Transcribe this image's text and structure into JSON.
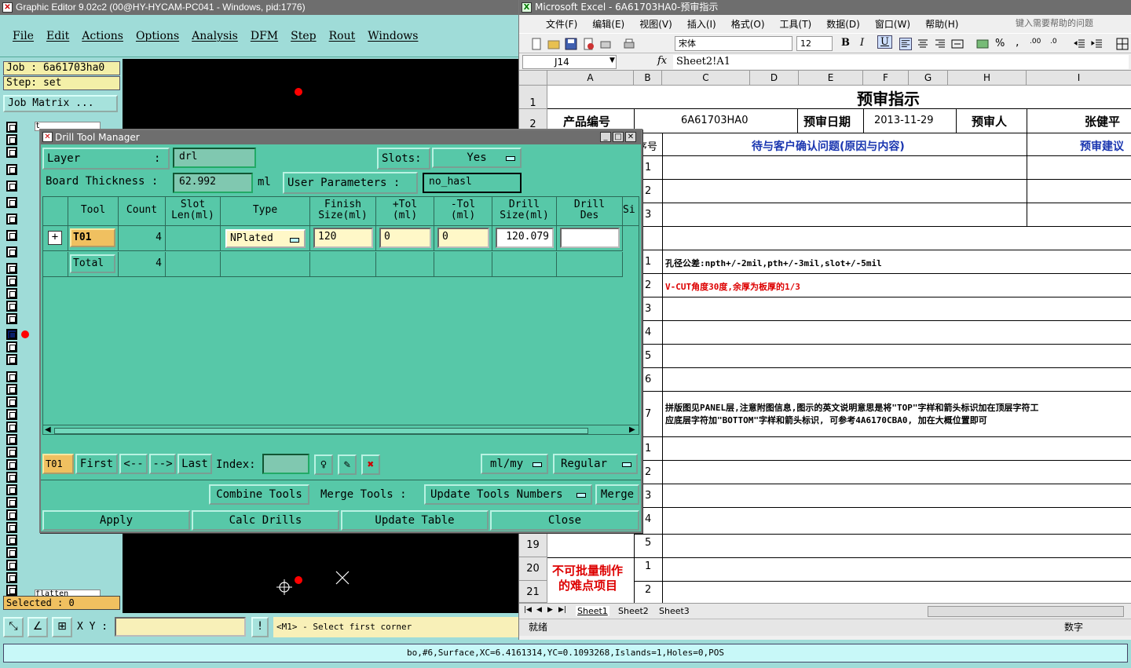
{
  "graphic_editor": {
    "title": "Graphic Editor 9.02c2 (00@HY-HYCAM-PC041 - Windows, pid:1776)",
    "menu": [
      "File",
      "Edit",
      "Actions",
      "Options",
      "Analysis",
      "DFM",
      "Step",
      "Rout",
      "Windows"
    ],
    "job_label": "Job : 6a61703ha0",
    "step_label": "Step: set",
    "job_matrix_button": "Job Matrix ...",
    "layer_last_name": "flatten",
    "layer_first_name": "t",
    "selected_label": "Selected : 0",
    "xy_label": "X Y :",
    "xy_value": "",
    "status_message": "<M1> - Select first corner",
    "bottom_info": "bo,#6,Surface,XC=6.4161314,YC=0.1093268,Islands=1,Holes=0,POS"
  },
  "drill_tool_manager": {
    "title": "Drill Tool Manager",
    "layer_label": "Layer",
    "layer_colon": ":",
    "layer_value": "drl",
    "slots_label": "Slots:",
    "slots_value": "Yes",
    "board_thickness_label": "Board Thickness :",
    "board_thickness_value": "62.992",
    "board_thickness_unit": "ml",
    "user_parameters_label": "User Parameters :",
    "user_parameters_value": "no_hasl",
    "columns": [
      "Tool",
      "Count",
      "Slot Len(ml)",
      "Type",
      "Finish Size(ml)",
      "+Tol (ml)",
      "-Tol (ml)",
      "Drill Size(ml)",
      "Drill Des",
      "Si"
    ],
    "row_tool": "T01",
    "row_count": "4",
    "row_type": "NPlated",
    "row_finish": "120",
    "row_ptol": "0",
    "row_ntol": "0",
    "row_drill_size": "120.079",
    "row_drill_des": "",
    "total_label": "Total",
    "total_count": "4",
    "nav_tool": "T01",
    "nav_first": "First",
    "nav_prev": "<--",
    "nav_next": "-->",
    "nav_last": "Last",
    "index_label": "Index:",
    "index_value": "",
    "units_value": "ml/my",
    "mode_value": "Regular",
    "combine_tools": "Combine Tools",
    "merge_tools_label": "Merge Tools :",
    "update_tools_numbers": "Update Tools Numbers",
    "merge": "Merge",
    "apply": "Apply",
    "calc_drills": "Calc Drills",
    "update_table": "Update Table",
    "close": "Close"
  },
  "excel": {
    "title": "Microsoft Excel - 6A61703HA0-预审指示",
    "menu": [
      "文件(F)",
      "编辑(E)",
      "视图(V)",
      "插入(I)",
      "格式(O)",
      "工具(T)",
      "数据(D)",
      "窗口(W)",
      "帮助(H)"
    ],
    "help_placeholder": "键入需要帮助的问题",
    "font_name": "宋体",
    "font_size": "12",
    "name_box": "J14",
    "fx": "fx",
    "formula": "Sheet2!A1",
    "columns": [
      "A",
      "B",
      "C",
      "D",
      "E",
      "F",
      "G",
      "H",
      "I"
    ],
    "rows": [
      "1",
      "2",
      "19",
      "20",
      "21"
    ],
    "heading": "预审指示",
    "product_code_label": "产品编号",
    "product_code_value": "6A61703HA0",
    "review_date_label": "预审日期",
    "review_date_value": "2013-11-29",
    "reviewer_label": "预审人",
    "reviewer_value": "张健平",
    "seq_label": "序号",
    "question_header": "待与客户确认问题(原因与内容)",
    "suggest_header": "预审建议",
    "seq_a": [
      "1",
      "2",
      "3"
    ],
    "seq_b": [
      "1",
      "2",
      "3",
      "4",
      "5",
      "6",
      "7"
    ],
    "seq_c": [
      "1",
      "2",
      "3",
      "4",
      "5"
    ],
    "seq_d": [
      "1",
      "2"
    ],
    "note1": "孔径公差:npth+/-2mil,pth+/-3mil,slot+/-5mil",
    "note2": "V-CUT角度30度,余厚为板厚的1/3",
    "note7a": "拼版图见PANEL层,注意附图信息,图示的英文说明意思是将\"TOP\"字样和箭头标识加在顶层字符工",
    "note7b": "应底层字符加\"BOTTOM\"字样和箭头标识, 可参考4A6170CBA0, 加在大概位置即可",
    "difficult_label_1": "不可批量制作",
    "difficult_label_2": "的难点项目",
    "sheets": [
      "Sheet1",
      "Sheet2",
      "Sheet3"
    ],
    "status_ready": "就绪",
    "status_num": "数字"
  }
}
